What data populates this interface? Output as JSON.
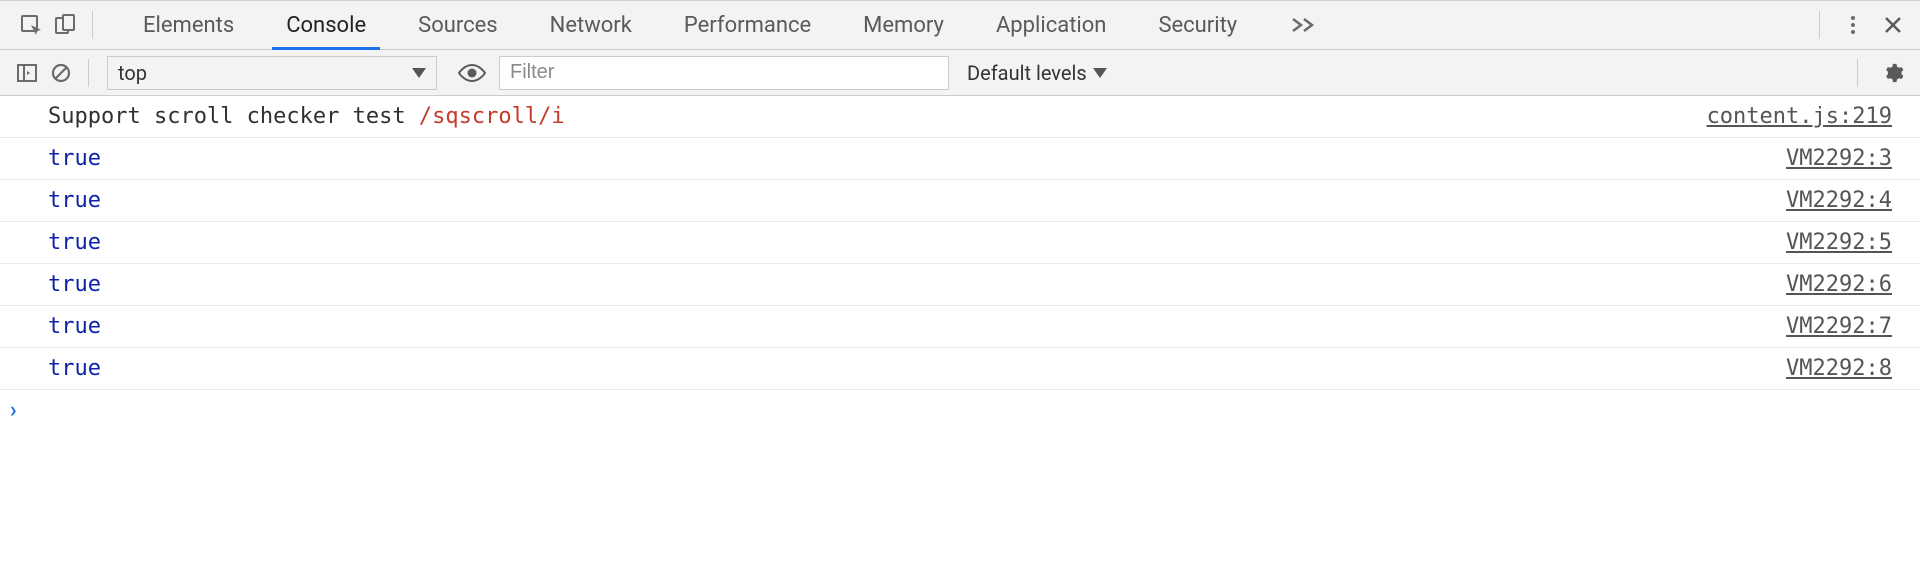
{
  "tabs": [
    "Elements",
    "Console",
    "Sources",
    "Network",
    "Performance",
    "Memory",
    "Application",
    "Security"
  ],
  "active_tab_index": 1,
  "toolbar": {
    "context": "top",
    "filter_placeholder": "Filter",
    "levels_label": "Default levels"
  },
  "log_rows": [
    {
      "parts": [
        {
          "kind": "text",
          "text": "Support scroll checker test "
        },
        {
          "kind": "regex",
          "text": "/sqscroll/i"
        }
      ],
      "source": "content.js:219"
    },
    {
      "parts": [
        {
          "kind": "bool",
          "text": "true"
        }
      ],
      "source": "VM2292:3"
    },
    {
      "parts": [
        {
          "kind": "bool",
          "text": "true"
        }
      ],
      "source": "VM2292:4"
    },
    {
      "parts": [
        {
          "kind": "bool",
          "text": "true"
        }
      ],
      "source": "VM2292:5"
    },
    {
      "parts": [
        {
          "kind": "bool",
          "text": "true"
        }
      ],
      "source": "VM2292:6"
    },
    {
      "parts": [
        {
          "kind": "bool",
          "text": "true"
        }
      ],
      "source": "VM2292:7"
    },
    {
      "parts": [
        {
          "kind": "bool",
          "text": "true"
        }
      ],
      "source": "VM2292:8"
    }
  ],
  "prompt": "›"
}
